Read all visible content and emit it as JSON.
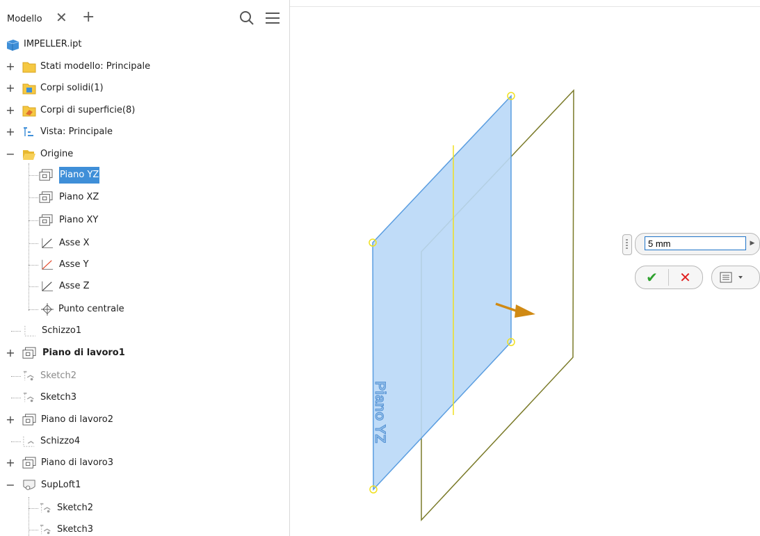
{
  "browser": {
    "tab_label": "Modello",
    "close_glyph": "✕",
    "add_glyph": "+",
    "search_icon": "search-icon",
    "menu_icon": "menu-icon",
    "items": [
      {
        "label": "IMPELLER.ipt",
        "icon": "part-icon"
      },
      {
        "label": "Stati modello: Principale",
        "icon": "folder-icon"
      },
      {
        "label": "Corpi solidi(1)",
        "icon": "solid-bodies-icon"
      },
      {
        "label": "Corpi di superficie(8)",
        "icon": "surface-bodies-icon"
      },
      {
        "label": "Vista: Principale",
        "icon": "view-icon"
      },
      {
        "label": "Origine",
        "icon": "open-folder-icon"
      },
      {
        "label": "Piano YZ",
        "icon": "plane-icon",
        "selected": true
      },
      {
        "label": "Piano XZ",
        "icon": "plane-icon"
      },
      {
        "label": "Piano XY",
        "icon": "plane-icon"
      },
      {
        "label": "Asse X",
        "icon": "axis-icon"
      },
      {
        "label": "Asse Y",
        "icon": "axis-icon"
      },
      {
        "label": "Asse Z",
        "icon": "axis-icon"
      },
      {
        "label": "Punto centrale",
        "icon": "center-point-icon"
      },
      {
        "label": "Schizzo1",
        "icon": "sketch-icon"
      },
      {
        "label": "Piano di lavoro1",
        "icon": "work-plane-icon"
      },
      {
        "label": "Sketch2",
        "icon": "sketch-icon"
      },
      {
        "label": "Sketch3",
        "icon": "sketch-icon"
      },
      {
        "label": "Piano di lavoro2",
        "icon": "work-plane-icon"
      },
      {
        "label": "Schizzo4",
        "icon": "sketch-icon"
      },
      {
        "label": "Piano di lavoro3",
        "icon": "work-plane-icon"
      },
      {
        "label": "SupLoft1",
        "icon": "loft-surface-icon"
      },
      {
        "label": "Sketch2",
        "icon": "sketch-icon"
      },
      {
        "label": "Sketch3",
        "icon": "sketch-icon"
      }
    ]
  },
  "viewport": {
    "plane_label": "Piano YZ",
    "colors": {
      "plane_fill": "#b9d8f7",
      "plane_edge": "#5a9de0",
      "preview_edge": "#7a7a28",
      "axis": "#f0e020",
      "grip": "#f0e020",
      "arrow": "#d08a14"
    }
  },
  "mini_toolbar": {
    "distance_value": "5 mm",
    "ok_glyph": "✔",
    "cancel_glyph": "✕",
    "options_icon": "options-menu-icon"
  }
}
